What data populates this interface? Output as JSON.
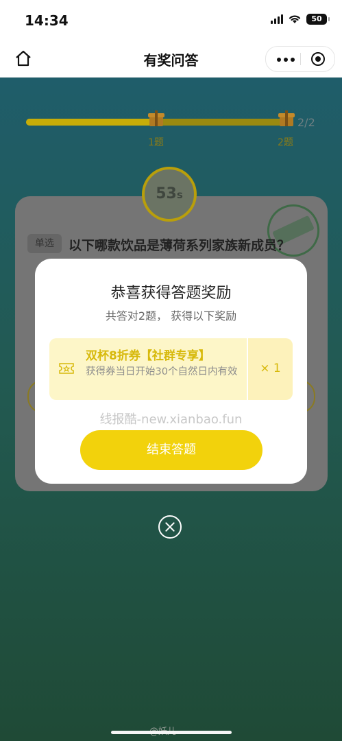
{
  "status_bar": {
    "time": "14:34",
    "battery": "50"
  },
  "nav": {
    "title": "有奖问答",
    "home_icon": "home-icon",
    "more_icon": "more-dots-icon",
    "target_icon": "target-icon"
  },
  "progress": {
    "steps": [
      "1题",
      "2题"
    ],
    "count": "2/2",
    "fraction": 0.5,
    "colors": {
      "track": "#9a8a10",
      "fill": "#c7ad08"
    }
  },
  "timer": {
    "value": "53",
    "unit": "s"
  },
  "question": {
    "tag": "单选",
    "text": "以下哪款饮品是薄荷系列家族新成员？"
  },
  "modal": {
    "title": "恭喜获得答题奖励",
    "subtitle": "共答对2题， 获得以下奖励",
    "reward": {
      "name": "双杯8折券【社群专享】",
      "desc": "获得券当日开始30个自然日内有效",
      "qty": "× 1",
      "icon": "ticket-icon"
    },
    "watermark": "线报酷-new.xianbao.fun",
    "finish_label": "结束答题",
    "accent": "#f2d20c"
  },
  "footer": {
    "watermark": "@妖儿"
  }
}
